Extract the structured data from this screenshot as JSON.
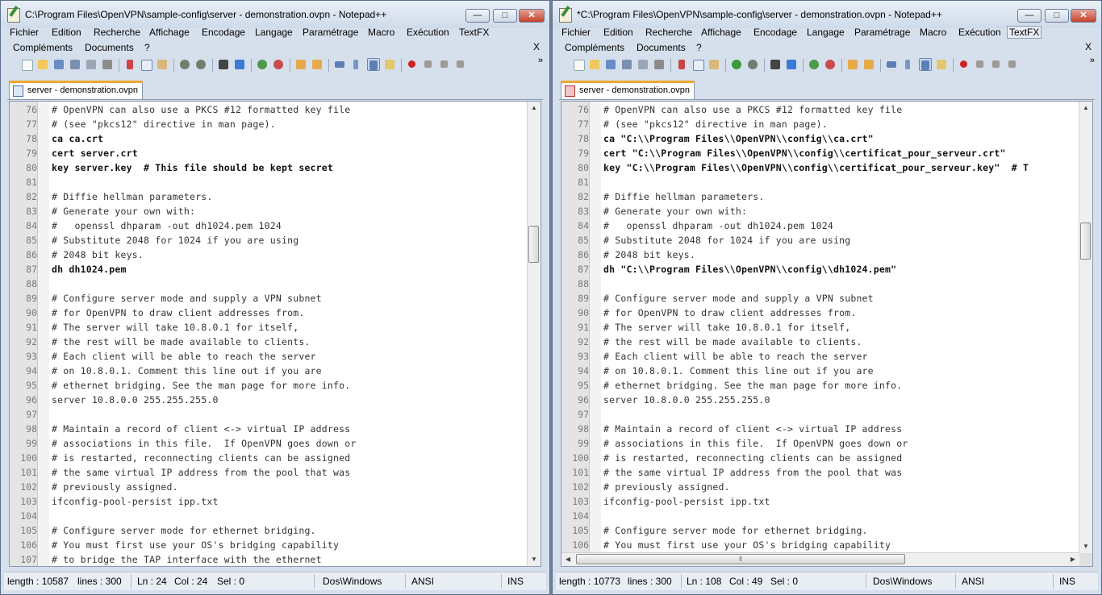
{
  "left_window": {
    "title": "C:\\Program Files\\OpenVPN\\sample-config\\server - demonstration.ovpn - Notepad++",
    "tab_label": "server - demonstration.ovpn",
    "status": {
      "length": "length : 10587",
      "lines": "lines : 300",
      "ln": "Ln : 24",
      "col": "Col : 24",
      "sel": "Sel : 0",
      "eol": "Dos\\Windows",
      "encoding": "ANSI",
      "mode": "INS"
    },
    "lines": [
      {
        "n": "76",
        "t": "# OpenVPN can also use a PKCS #12 formatted key file",
        "cmd": false
      },
      {
        "n": "77",
        "t": "# (see \"pkcs12\" directive in man page).",
        "cmd": false
      },
      {
        "n": "78",
        "t": "ca ca.crt",
        "cmd": true
      },
      {
        "n": "79",
        "t": "cert server.crt",
        "cmd": true
      },
      {
        "n": "80",
        "t": "key server.key  # This file should be kept secret",
        "cmd": true
      },
      {
        "n": "81",
        "t": "",
        "cmd": false
      },
      {
        "n": "82",
        "t": "# Diffie hellman parameters.",
        "cmd": false
      },
      {
        "n": "83",
        "t": "# Generate your own with:",
        "cmd": false
      },
      {
        "n": "84",
        "t": "#   openssl dhparam -out dh1024.pem 1024",
        "cmd": false
      },
      {
        "n": "85",
        "t": "# Substitute 2048 for 1024 if you are using",
        "cmd": false
      },
      {
        "n": "86",
        "t": "# 2048 bit keys.",
        "cmd": false
      },
      {
        "n": "87",
        "t": "dh dh1024.pem",
        "cmd": true
      },
      {
        "n": "88",
        "t": "",
        "cmd": false
      },
      {
        "n": "89",
        "t": "# Configure server mode and supply a VPN subnet",
        "cmd": false
      },
      {
        "n": "90",
        "t": "# for OpenVPN to draw client addresses from.",
        "cmd": false
      },
      {
        "n": "91",
        "t": "# The server will take 10.8.0.1 for itself,",
        "cmd": false
      },
      {
        "n": "92",
        "t": "# the rest will be made available to clients.",
        "cmd": false
      },
      {
        "n": "93",
        "t": "# Each client will be able to reach the server",
        "cmd": false
      },
      {
        "n": "94",
        "t": "# on 10.8.0.1. Comment this line out if you are",
        "cmd": false
      },
      {
        "n": "95",
        "t": "# ethernet bridging. See the man page for more info.",
        "cmd": false
      },
      {
        "n": "96",
        "t": "server 10.8.0.0 255.255.255.0",
        "cmd": false
      },
      {
        "n": "97",
        "t": "",
        "cmd": false
      },
      {
        "n": "98",
        "t": "# Maintain a record of client <-> virtual IP address",
        "cmd": false
      },
      {
        "n": "99",
        "t": "# associations in this file.  If OpenVPN goes down or",
        "cmd": false
      },
      {
        "n": "100",
        "t": "# is restarted, reconnecting clients can be assigned",
        "cmd": false
      },
      {
        "n": "101",
        "t": "# the same virtual IP address from the pool that was",
        "cmd": false
      },
      {
        "n": "102",
        "t": "# previously assigned.",
        "cmd": false
      },
      {
        "n": "103",
        "t": "ifconfig-pool-persist ipp.txt",
        "cmd": false
      },
      {
        "n": "104",
        "t": "",
        "cmd": false
      },
      {
        "n": "105",
        "t": "# Configure server mode for ethernet bridging.",
        "cmd": false
      },
      {
        "n": "106",
        "t": "# You must first use your OS's bridging capability",
        "cmd": false
      },
      {
        "n": "107",
        "t": "# to bridge the TAP interface with the ethernet",
        "cmd": false
      }
    ]
  },
  "right_window": {
    "title": "*C:\\Program Files\\OpenVPN\\sample-config\\server - demonstration.ovpn - Notepad++",
    "tab_label": "server - demonstration.ovpn",
    "status": {
      "length": "length : 10773",
      "lines": "lines : 300",
      "ln": "Ln : 108",
      "col": "Col : 49",
      "sel": "Sel : 0",
      "eol": "Dos\\Windows",
      "encoding": "ANSI",
      "mode": "INS"
    },
    "lines": [
      {
        "n": "76",
        "t": "# OpenVPN can also use a PKCS #12 formatted key file",
        "cmd": false
      },
      {
        "n": "77",
        "t": "# (see \"pkcs12\" directive in man page).",
        "cmd": false
      },
      {
        "n": "78",
        "t": "ca \"C:\\\\Program Files\\\\OpenVPN\\\\config\\\\ca.crt\"",
        "cmd": true
      },
      {
        "n": "79",
        "t": "cert \"C:\\\\Program Files\\\\OpenVPN\\\\config\\\\certificat_pour_serveur.crt\"",
        "cmd": true
      },
      {
        "n": "80",
        "t": "key \"C:\\\\Program Files\\\\OpenVPN\\\\config\\\\certificat_pour_serveur.key\"  # T",
        "cmd": true
      },
      {
        "n": "81",
        "t": "",
        "cmd": false
      },
      {
        "n": "82",
        "t": "# Diffie hellman parameters.",
        "cmd": false
      },
      {
        "n": "83",
        "t": "# Generate your own with:",
        "cmd": false
      },
      {
        "n": "84",
        "t": "#   openssl dhparam -out dh1024.pem 1024",
        "cmd": false
      },
      {
        "n": "85",
        "t": "# Substitute 2048 for 1024 if you are using",
        "cmd": false
      },
      {
        "n": "86",
        "t": "# 2048 bit keys.",
        "cmd": false
      },
      {
        "n": "87",
        "t": "dh \"C:\\\\Program Files\\\\OpenVPN\\\\config\\\\dh1024.pem\"",
        "cmd": true
      },
      {
        "n": "88",
        "t": "",
        "cmd": false
      },
      {
        "n": "89",
        "t": "# Configure server mode and supply a VPN subnet",
        "cmd": false
      },
      {
        "n": "90",
        "t": "# for OpenVPN to draw client addresses from.",
        "cmd": false
      },
      {
        "n": "91",
        "t": "# The server will take 10.8.0.1 for itself,",
        "cmd": false
      },
      {
        "n": "92",
        "t": "# the rest will be made available to clients.",
        "cmd": false
      },
      {
        "n": "93",
        "t": "# Each client will be able to reach the server",
        "cmd": false
      },
      {
        "n": "94",
        "t": "# on 10.8.0.1. Comment this line out if you are",
        "cmd": false
      },
      {
        "n": "95",
        "t": "# ethernet bridging. See the man page for more info.",
        "cmd": false
      },
      {
        "n": "96",
        "t": "server 10.8.0.0 255.255.255.0",
        "cmd": false
      },
      {
        "n": "97",
        "t": "",
        "cmd": false
      },
      {
        "n": "98",
        "t": "# Maintain a record of client <-> virtual IP address",
        "cmd": false
      },
      {
        "n": "99",
        "t": "# associations in this file.  If OpenVPN goes down or",
        "cmd": false
      },
      {
        "n": "100",
        "t": "# is restarted, reconnecting clients can be assigned",
        "cmd": false
      },
      {
        "n": "101",
        "t": "# the same virtual IP address from the pool that was",
        "cmd": false
      },
      {
        "n": "102",
        "t": "# previously assigned.",
        "cmd": false
      },
      {
        "n": "103",
        "t": "ifconfig-pool-persist ipp.txt",
        "cmd": false
      },
      {
        "n": "104",
        "t": "",
        "cmd": false
      },
      {
        "n": "105",
        "t": "# Configure server mode for ethernet bridging.",
        "cmd": false
      },
      {
        "n": "106",
        "t": "# You must first use your OS's bridging capability",
        "cmd": false
      }
    ]
  },
  "menu": {
    "row1": [
      "Fichier",
      "Edition",
      "Recherche",
      "Affichage",
      "Encodage",
      "Langage",
      "Paramétrage",
      "Macro",
      "Exécution",
      "TextFX"
    ],
    "row2": [
      "Compléments",
      "Documents",
      "?"
    ],
    "close_x": "X"
  },
  "window_controls": {
    "minimize": "—",
    "maximize": "□",
    "close": "✕"
  },
  "toolbar_icons": [
    "new-file-icon",
    "open-file-icon",
    "save-icon",
    "save-all-icon",
    "close-file-icon",
    "print-icon",
    "cut-icon",
    "copy-icon",
    "paste-icon",
    "undo-icon",
    "redo-icon",
    "find-icon",
    "replace-icon",
    "zoom-in-icon",
    "zoom-out-icon",
    "sync-vertical-icon",
    "sync-horizontal-icon",
    "word-wrap-icon",
    "show-all-chars-icon",
    "indent-guide-icon",
    "function-list-icon",
    "record-macro-icon",
    "stop-record-icon",
    "play-macro-icon",
    "run-macro-multiple-icon"
  ],
  "toolbar_chevron": "»",
  "colors": {
    "tab_accent": "#f0a830",
    "window_frame": "#d6dfec",
    "comment_text": "#333333"
  }
}
